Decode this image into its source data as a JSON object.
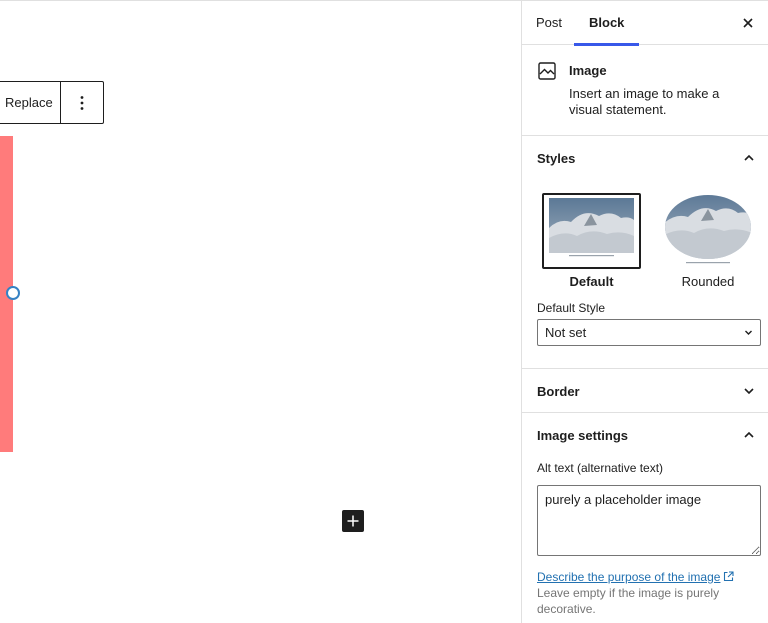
{
  "toolbar": {
    "replace_label": "Replace",
    "more_icon": "vertical-ellipsis-icon"
  },
  "sidebar": {
    "tabs": [
      {
        "label": "Post"
      },
      {
        "label": "Block"
      }
    ],
    "active_tab": "Block",
    "close_icon": "close-icon",
    "block_card": {
      "icon": "image-icon",
      "title": "Image",
      "description": "Insert an image to make a visual statement."
    },
    "styles": {
      "title": "Styles",
      "options": [
        {
          "label": "Default"
        },
        {
          "label": "Rounded"
        }
      ],
      "selected": "Default",
      "default_style_label": "Default Style",
      "default_style_value": "Not set"
    },
    "border": {
      "title": "Border"
    },
    "image_settings": {
      "title": "Image settings",
      "alt_label": "Alt text (alternative text)",
      "alt_value": "purely a placeholder image",
      "help_link": "Describe the purpose of the image",
      "help_text": "Leave empty if the image is purely decorative."
    }
  },
  "colors": {
    "accent": "#3858e9",
    "image_placeholder": "#ff7b7b",
    "link": "#2271b1",
    "handle": "#3582c4"
  }
}
